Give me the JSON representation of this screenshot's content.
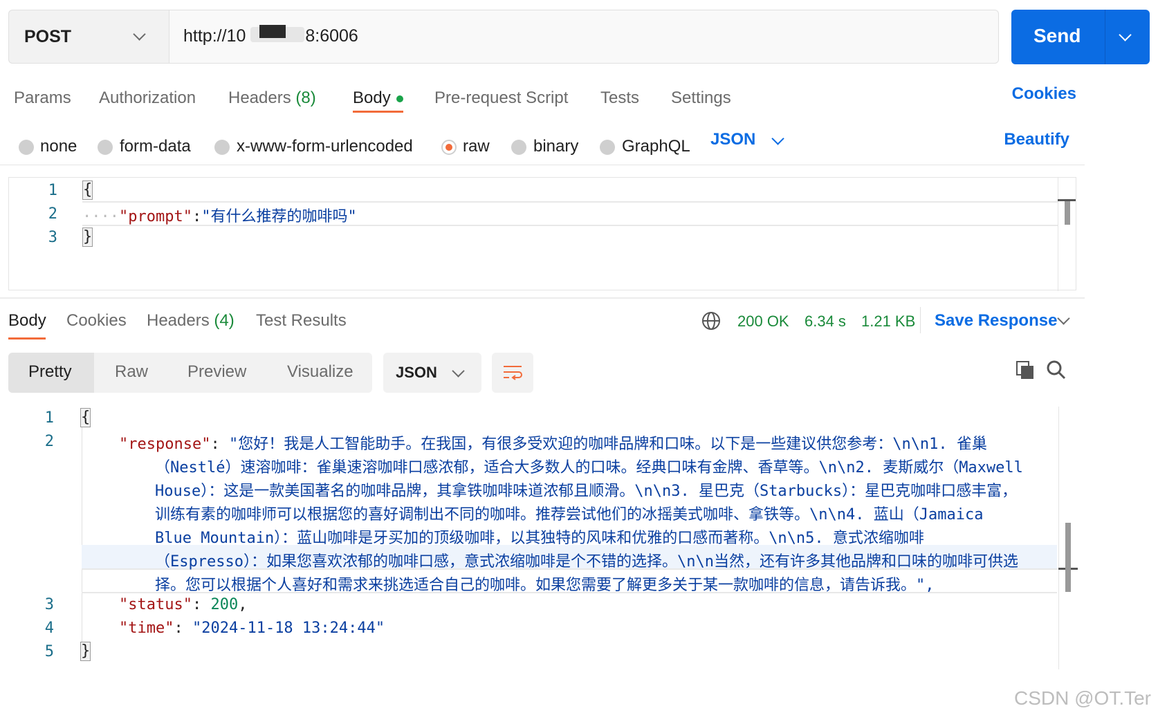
{
  "request": {
    "method": "POST",
    "url": "http://10▇▇8:6006",
    "url_prefix": "http://10",
    "url_suffix": "8:6006",
    "send_label": "Send"
  },
  "request_tabs": [
    {
      "label": "Params"
    },
    {
      "label": "Authorization"
    },
    {
      "label": "Headers",
      "count": "(8)"
    },
    {
      "label": "Body"
    },
    {
      "label": "Pre-request Script"
    },
    {
      "label": "Tests"
    },
    {
      "label": "Settings"
    }
  ],
  "cookies_link": "Cookies",
  "body_types": [
    "none",
    "form-data",
    "x-www-form-urlencoded",
    "raw",
    "binary",
    "GraphQL"
  ],
  "body_format": "JSON",
  "beautify_label": "Beautify",
  "request_body": {
    "line_numbers": [
      "1",
      "2",
      "3"
    ],
    "open_brace": "{",
    "indent_dots": "····",
    "key": "\"prompt\"",
    "colon": ":",
    "value": "\"有什么推荐的咖啡吗\"",
    "close_brace": "}"
  },
  "response_tabs": [
    {
      "label": "Body"
    },
    {
      "label": "Cookies"
    },
    {
      "label": "Headers",
      "count": "(4)"
    },
    {
      "label": "Test Results"
    }
  ],
  "response_status": {
    "status": "200 OK",
    "time": "6.34 s",
    "size": "1.21 KB"
  },
  "save_response_label": "Save Response",
  "view_modes": [
    "Pretty",
    "Raw",
    "Preview",
    "Visualize"
  ],
  "response_format": "JSON",
  "response_body": {
    "line_numbers": [
      "1",
      "2",
      "3",
      "4",
      "5"
    ],
    "open_brace": "{",
    "response_key": "\"response\"",
    "response_lines": [
      "\"您好！我是人工智能助手。在我国，有很多受欢迎的咖啡品牌和口味。以下是一些建议供您参考：\\n\\n1. 雀巢",
      "（Nestlé）速溶咖啡：雀巢速溶咖啡口感浓郁，适合大多数人的口味。经典口味有金牌、香草等。\\n\\n2. 麦斯威尔（Maxwell",
      "House）：这是一款美国著名的咖啡品牌，其拿铁咖啡味道浓郁且顺滑。\\n\\n3. 星巴克（Starbucks）：星巴克咖啡口感丰富，",
      "训练有素的咖啡师可以根据您的喜好调制出不同的咖啡。推荐尝试他们的冰摇美式咖啡、拿铁等。\\n\\n4. 蓝山（Jamaica",
      "Blue Mountain）：蓝山咖啡是牙买加的顶级咖啡，以其独特的风味和优雅的口感而著称。\\n\\n5. 意式浓缩咖啡",
      "（Espresso）：如果您喜欢浓郁的咖啡口感，意式浓缩咖啡是个不错的选择。\\n\\n当然，还有许多其他品牌和口味的咖啡可供选",
      "择。您可以根据个人喜好和需求来挑选适合自己的咖啡。如果您需要了解更多关于某一款咖啡的信息，请告诉我。\","
    ],
    "status_key": "\"status\"",
    "status_value": "200",
    "time_key": "\"time\"",
    "time_value": "\"2024-11-18 13:24:44\"",
    "close_brace": "}"
  },
  "watermark": "CSDN @OT.Ter",
  "colors": {
    "accent": "#0b6ce3",
    "orange": "#f26b3a",
    "status_green": "#1a8a3a"
  }
}
